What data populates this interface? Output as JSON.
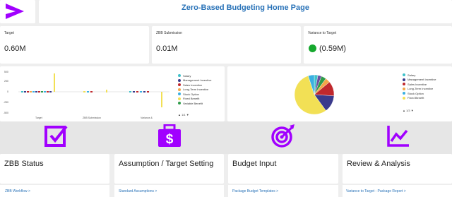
{
  "header": {
    "title": "Zero-Based Budgeting Home Page",
    "brand_color": "#a100ff"
  },
  "kpis": {
    "target": {
      "label": "Target",
      "value": "0.60M"
    },
    "zbb_submission": {
      "label": "ZBB Submission",
      "value": "0.01M"
    },
    "variance": {
      "label": "Variance to Target",
      "value": "(0.59M)",
      "status_color": "#16a82e"
    }
  },
  "bar_chart": {
    "chart_data": {
      "type": "bar",
      "categories": [
        "Target",
        "ZBB Submission",
        "Variance &"
      ],
      "ytick_labels": [
        "500",
        "250",
        "0",
        "-250",
        "-500"
      ],
      "legend": [
        "Salary",
        "Management Incentive",
        "Sales Incentive",
        "Long-Term Incentive",
        "Stock Option",
        "Fixed Benefit",
        "Variable Benefit"
      ],
      "legend_colors": [
        "#3fc1c9",
        "#3a3a8c",
        "#c0282d",
        "#f2a649",
        "#3ab0e2",
        "#f2e055",
        "#2e9c4a"
      ]
    },
    "pager": "▲ 1/1 ▼"
  },
  "pie_chart": {
    "chart_data": {
      "type": "pie",
      "legend": [
        "Salary",
        "Management Incentive",
        "Sales Incentive",
        "Long-Term Incentive",
        "Stock Option",
        "Fixed Benefit"
      ],
      "legend_colors": [
        "#3fc1c9",
        "#3a3a8c",
        "#c0282d",
        "#f2a649",
        "#3ab0e2",
        "#f2e055"
      ]
    },
    "pager": "▲ 1/3 ▼"
  },
  "sections": {
    "zbb_status": {
      "title": "ZBB Status",
      "link": "ZBB Workflow >"
    },
    "assumption": {
      "title": "Assumption / Target Setting",
      "link": "Standard Assumptions >"
    },
    "budget_input": {
      "title": "Budget Input",
      "link": "Package Budget Templates >"
    },
    "review": {
      "title": "Review & Analysis",
      "link": "Variance to Target - Package Report >"
    }
  },
  "icons": {
    "zbb_status": "checkbox-icon",
    "assumption": "dollar-briefcase-icon",
    "budget_input": "target-icon",
    "review": "line-chart-icon"
  }
}
